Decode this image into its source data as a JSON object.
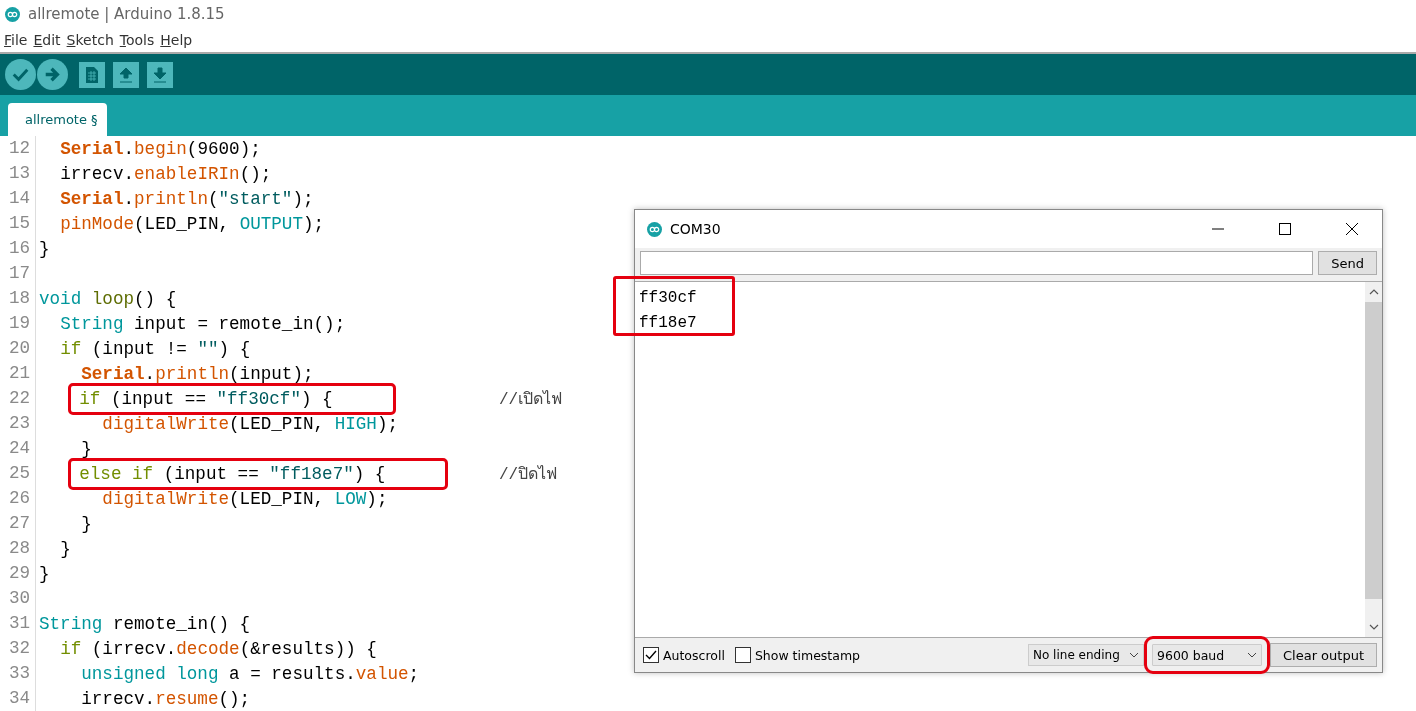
{
  "window": {
    "title": "allremote | Arduino 1.8.15"
  },
  "menu": [
    "File",
    "Edit",
    "Sketch",
    "Tools",
    "Help"
  ],
  "tabs": [
    {
      "label": "allremote §",
      "selected": true
    }
  ],
  "editor": {
    "lines": [
      {
        "number": "12",
        "tokens": [
          {
            "kind": "class",
            "text": "  Serial"
          },
          {
            "kind": "plain",
            "text": "."
          },
          {
            "kind": "func",
            "text": "begin"
          },
          {
            "kind": "plain",
            "text": "(9600);"
          }
        ]
      },
      {
        "number": "13",
        "tokens": [
          {
            "kind": "plain",
            "text": "  irrecv."
          },
          {
            "kind": "func",
            "text": "enableIRIn"
          },
          {
            "kind": "plain",
            "text": "();"
          }
        ]
      },
      {
        "number": "14",
        "tokens": [
          {
            "kind": "class",
            "text": "  Serial"
          },
          {
            "kind": "plain",
            "text": "."
          },
          {
            "kind": "func",
            "text": "println"
          },
          {
            "kind": "plain",
            "text": "("
          },
          {
            "kind": "string",
            "text": "\"start\""
          },
          {
            "kind": "plain",
            "text": ");"
          }
        ]
      },
      {
        "number": "15",
        "tokens": [
          {
            "kind": "func",
            "text": "  pinMode"
          },
          {
            "kind": "plain",
            "text": "(LED_PIN, "
          },
          {
            "kind": "type",
            "text": "OUTPUT"
          },
          {
            "kind": "plain",
            "text": ");"
          }
        ]
      },
      {
        "number": "16",
        "tokens": [
          {
            "kind": "plain",
            "text": "}"
          }
        ]
      },
      {
        "number": "17"
      },
      {
        "number": "18",
        "tokens": [
          {
            "kind": "type",
            "text": "void"
          },
          {
            "kind": "name",
            "text": " loop"
          },
          {
            "kind": "plain",
            "text": "() {"
          }
        ]
      },
      {
        "number": "19",
        "tokens": [
          {
            "kind": "type",
            "text": "  String"
          },
          {
            "kind": "plain",
            "text": " input = remote_in();"
          }
        ]
      },
      {
        "number": "20",
        "tokens": [
          {
            "kind": "keyword",
            "text": "  if"
          },
          {
            "kind": "plain",
            "text": " (input != "
          },
          {
            "kind": "string",
            "text": "\"\""
          },
          {
            "kind": "plain",
            "text": ") {"
          }
        ]
      },
      {
        "number": "21",
        "tokens": [
          {
            "kind": "class",
            "text": "    Serial"
          },
          {
            "kind": "plain",
            "text": "."
          },
          {
            "kind": "func",
            "text": "println"
          },
          {
            "kind": "plain",
            "text": "(input);"
          }
        ]
      },
      {
        "number": "22",
        "highlighted": true,
        "comment": "//เปิดไฟ",
        "tokens": [
          {
            "kind": "keyword",
            "text": "    if"
          },
          {
            "kind": "plain",
            "text": " (input == "
          },
          {
            "kind": "string",
            "text": "\"ff30cf\""
          },
          {
            "kind": "plain",
            "text": ") {"
          }
        ]
      },
      {
        "number": "23",
        "tokens": [
          {
            "kind": "func",
            "text": "      digitalWrite"
          },
          {
            "kind": "plain",
            "text": "(LED_PIN, "
          },
          {
            "kind": "type",
            "text": "HIGH"
          },
          {
            "kind": "plain",
            "text": ");"
          }
        ]
      },
      {
        "number": "24",
        "tokens": [
          {
            "kind": "plain",
            "text": "    }"
          }
        ]
      },
      {
        "number": "25",
        "highlighted": true,
        "comment": "//ปิดไฟ",
        "tokens": [
          {
            "kind": "keyword",
            "text": "    else if"
          },
          {
            "kind": "plain",
            "text": " (input == "
          },
          {
            "kind": "string",
            "text": "\"ff18e7\""
          },
          {
            "kind": "plain",
            "text": ") {"
          }
        ]
      },
      {
        "number": "26",
        "tokens": [
          {
            "kind": "func",
            "text": "      digitalWrite"
          },
          {
            "kind": "plain",
            "text": "(LED_PIN, "
          },
          {
            "kind": "type",
            "text": "LOW"
          },
          {
            "kind": "plain",
            "text": ");"
          }
        ]
      },
      {
        "number": "27",
        "tokens": [
          {
            "kind": "plain",
            "text": "    }"
          }
        ]
      },
      {
        "number": "28",
        "tokens": [
          {
            "kind": "plain",
            "text": "  }"
          }
        ]
      },
      {
        "number": "29",
        "tokens": [
          {
            "kind": "plain",
            "text": "}"
          }
        ]
      },
      {
        "number": "30"
      },
      {
        "number": "31",
        "tokens": [
          {
            "kind": "type",
            "text": "String"
          },
          {
            "kind": "plain",
            "text": " remote_in() {"
          }
        ]
      },
      {
        "number": "32",
        "tokens": [
          {
            "kind": "keyword",
            "text": "  if"
          },
          {
            "kind": "plain",
            "text": " (irrecv."
          },
          {
            "kind": "func",
            "text": "decode"
          },
          {
            "kind": "plain",
            "text": "(&results)) {"
          }
        ]
      },
      {
        "number": "33",
        "tokens": [
          {
            "kind": "type",
            "text": "    unsigned long"
          },
          {
            "kind": "plain",
            "text": " a = results."
          },
          {
            "kind": "func",
            "text": "value"
          },
          {
            "kind": "plain",
            "text": ";"
          }
        ]
      },
      {
        "number": "34",
        "tokens": [
          {
            "kind": "plain",
            "text": "    irrecv."
          },
          {
            "kind": "func",
            "text": "resume"
          },
          {
            "kind": "plain",
            "text": "();"
          }
        ]
      }
    ]
  },
  "serial_monitor": {
    "title": "COM30",
    "send_button": "Send",
    "output": {
      "lines": [
        "ff30cf",
        "ff18e7"
      ],
      "highlighted": true
    },
    "autoscroll": {
      "label": "Autoscroll",
      "checked": true
    },
    "show_timestamp": {
      "label": "Show timestamp",
      "checked": false
    },
    "line_ending": {
      "value": "No line ending",
      "highlighted": false
    },
    "baud": {
      "value": "9600 baud",
      "highlighted": true
    },
    "clear_button": "Clear output"
  }
}
